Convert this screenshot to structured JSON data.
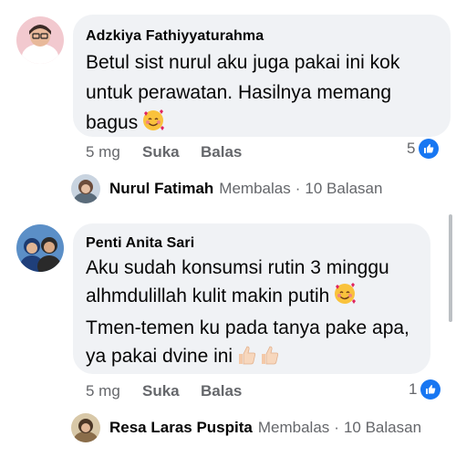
{
  "comments": [
    {
      "author": "Adzkiya Fathiyyaturahma",
      "lines": [
        "Betul sist nurul aku juga pakai ini kok",
        "untuk perawatan. Hasilnya memang",
        "bagus"
      ],
      "emoji": "smiling-face-with-hearts",
      "time": "5 mg",
      "like_label": "Suka",
      "reply_label": "Balas",
      "reaction_count": "5",
      "reply": {
        "name": "Nurul Fatimah",
        "action": "Membalas",
        "separator": "·",
        "count_text": "10 Balasan"
      }
    },
    {
      "author": "Penti Anita Sari",
      "lines": [
        "Aku sudah konsumsi rutin 3 minggu",
        "alhmdulillah kulit makin putih",
        "Tmen-temen ku pada tanya pake apa,",
        "ya pakai dvine ini"
      ],
      "emoji": "smiling-face-with-hearts",
      "emoji2": "thumbs-up",
      "time": "5 mg",
      "like_label": "Suka",
      "reply_label": "Balas",
      "reaction_count": "1",
      "reply": {
        "name": "Resa Laras Puspita",
        "action": "Membalas",
        "separator": "·",
        "count_text": "10 Balasan"
      }
    }
  ],
  "colors": {
    "bubble": "#f0f2f5",
    "meta_text": "#65676b",
    "like_blue": "#1877f2"
  }
}
